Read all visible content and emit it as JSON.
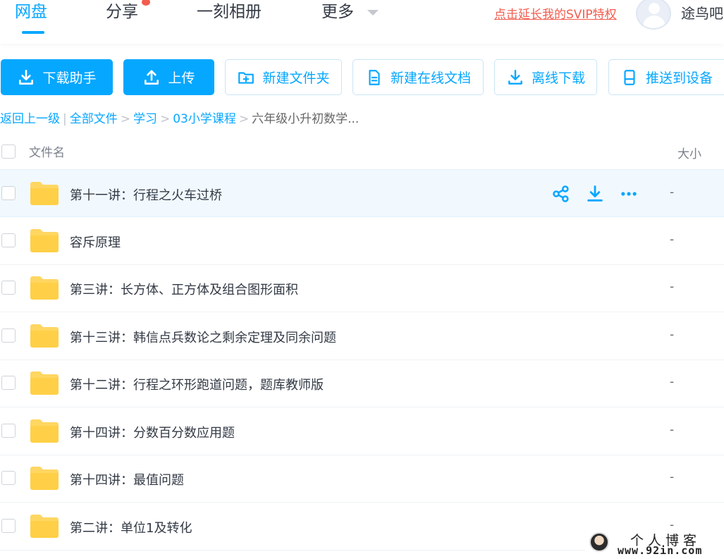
{
  "nav": {
    "items": [
      {
        "label": "网盘",
        "active": true
      },
      {
        "label": "分享",
        "badge": true
      },
      {
        "label": "一刻相册"
      },
      {
        "label": "更多",
        "dropdown": true
      }
    ],
    "promo": "点击延长我的SVIP特权",
    "username": "途鸟吧"
  },
  "toolbar": {
    "buttons": [
      {
        "label": "下载助手",
        "icon": "download-icon",
        "style": "primary"
      },
      {
        "label": "上传",
        "icon": "upload-icon",
        "style": "primary"
      },
      {
        "label": "新建文件夹",
        "icon": "new-folder-icon",
        "style": "secondary"
      },
      {
        "label": "新建在线文档",
        "icon": "document-icon",
        "style": "secondary"
      },
      {
        "label": "离线下载",
        "icon": "download-icon",
        "style": "secondary"
      },
      {
        "label": "推送到设备",
        "icon": "device-icon",
        "style": "secondary"
      }
    ]
  },
  "breadcrumb": {
    "back": "返回上一级",
    "divider": "|",
    "path": [
      "全部文件",
      "学习",
      "03小学课程"
    ],
    "current": "六年级小升初数学..."
  },
  "table": {
    "columns": {
      "name": "文件名",
      "size": "大小"
    },
    "rows": [
      {
        "name": "第十一讲：行程之火车过桥",
        "size": "-",
        "hover": true
      },
      {
        "name": "容斥原理",
        "size": "-"
      },
      {
        "name": "第三讲：长方体、正方体及组合图形面积",
        "size": "-"
      },
      {
        "name": "第十三讲：韩信点兵数论之剩余定理及同余问题",
        "size": "-"
      },
      {
        "name": "第十二讲：行程之环形跑道问题，题库教师版",
        "size": "-"
      },
      {
        "name": "第十四讲：分数百分数应用题",
        "size": "-"
      },
      {
        "name": "第十四讲：最值问题",
        "size": "-"
      },
      {
        "name": "第二讲：单位1及转化",
        "size": "-"
      }
    ],
    "row_actions": [
      "share-icon",
      "download-icon",
      "more-icon"
    ]
  },
  "watermark": {
    "line1": "个人博客",
    "line2": "www.92in.com"
  },
  "colors": {
    "accent": "#06a7ff",
    "promo": "#f25d4f",
    "folder": "#ffd661",
    "hover_row": "#f1f9ff"
  }
}
